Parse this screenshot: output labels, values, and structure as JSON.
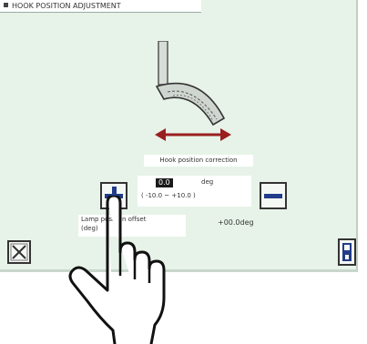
{
  "screen": {
    "title": "HOOK POSITION ADJUSTMENT"
  },
  "hook_panel": {
    "label": "Hook position correction",
    "current_value": "0.0",
    "unit": "deg",
    "range": "( -10.0 ~ +10.0 )"
  },
  "offset": {
    "note_line1": "Lamp position offset",
    "note_line2": "(deg)",
    "value_text": "+00.0deg"
  },
  "buttons": {
    "plus_icon": "plus-icon",
    "minus_icon": "minus-icon",
    "close_icon": "close-icon",
    "save_icon": "save-icon"
  },
  "colors": {
    "panel_bg": "#e7f3e8",
    "arrow": "#9a1f1f",
    "button_icon": "#223c8a"
  }
}
